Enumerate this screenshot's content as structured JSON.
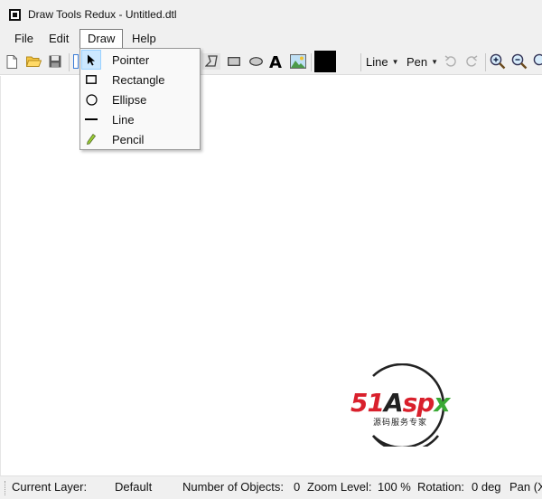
{
  "window": {
    "title": "Draw Tools Redux - Untitled.dtl"
  },
  "menubar": {
    "items": [
      "File",
      "Edit",
      "Draw",
      "Help"
    ]
  },
  "toolbar": {
    "line_dropdown": "Line",
    "pen_dropdown": "Pen",
    "fill_color": "#000000",
    "icons": [
      "new-file-icon",
      "open-folder-icon",
      "save-icon",
      "polygon-icon",
      "rectangle-icon",
      "ellipse-icon",
      "text-icon",
      "image-icon",
      "undo-icon",
      "redo-icon",
      "zoom-in-icon",
      "zoom-out-icon"
    ]
  },
  "draw_menu": {
    "items": [
      {
        "label": "Pointer",
        "icon": "pointer-icon",
        "selected": true
      },
      {
        "label": "Rectangle",
        "icon": "rectangle-icon",
        "selected": false
      },
      {
        "label": "Ellipse",
        "icon": "ellipse-icon",
        "selected": false
      },
      {
        "label": "Line",
        "icon": "line-icon",
        "selected": false
      },
      {
        "label": "Pencil",
        "icon": "pencil-icon",
        "selected": false
      }
    ]
  },
  "status": {
    "layer_label": "Current Layer:",
    "layer_value": "Default",
    "objects_label": "Number of Objects:",
    "objects_value": "0",
    "zoom_label": "Zoom Level:",
    "zoom_value": "100 %",
    "rotation_label": "Rotation:",
    "rotation_value": "0 deg",
    "pan_label": "Pan (X"
  },
  "watermark": {
    "brand": "51Aspx",
    "subtitle": "源码服务专家"
  },
  "colors": {
    "brand_red": "#d9202c",
    "brand_green": "#3aa935",
    "menu_highlight": "#cce8ff"
  }
}
